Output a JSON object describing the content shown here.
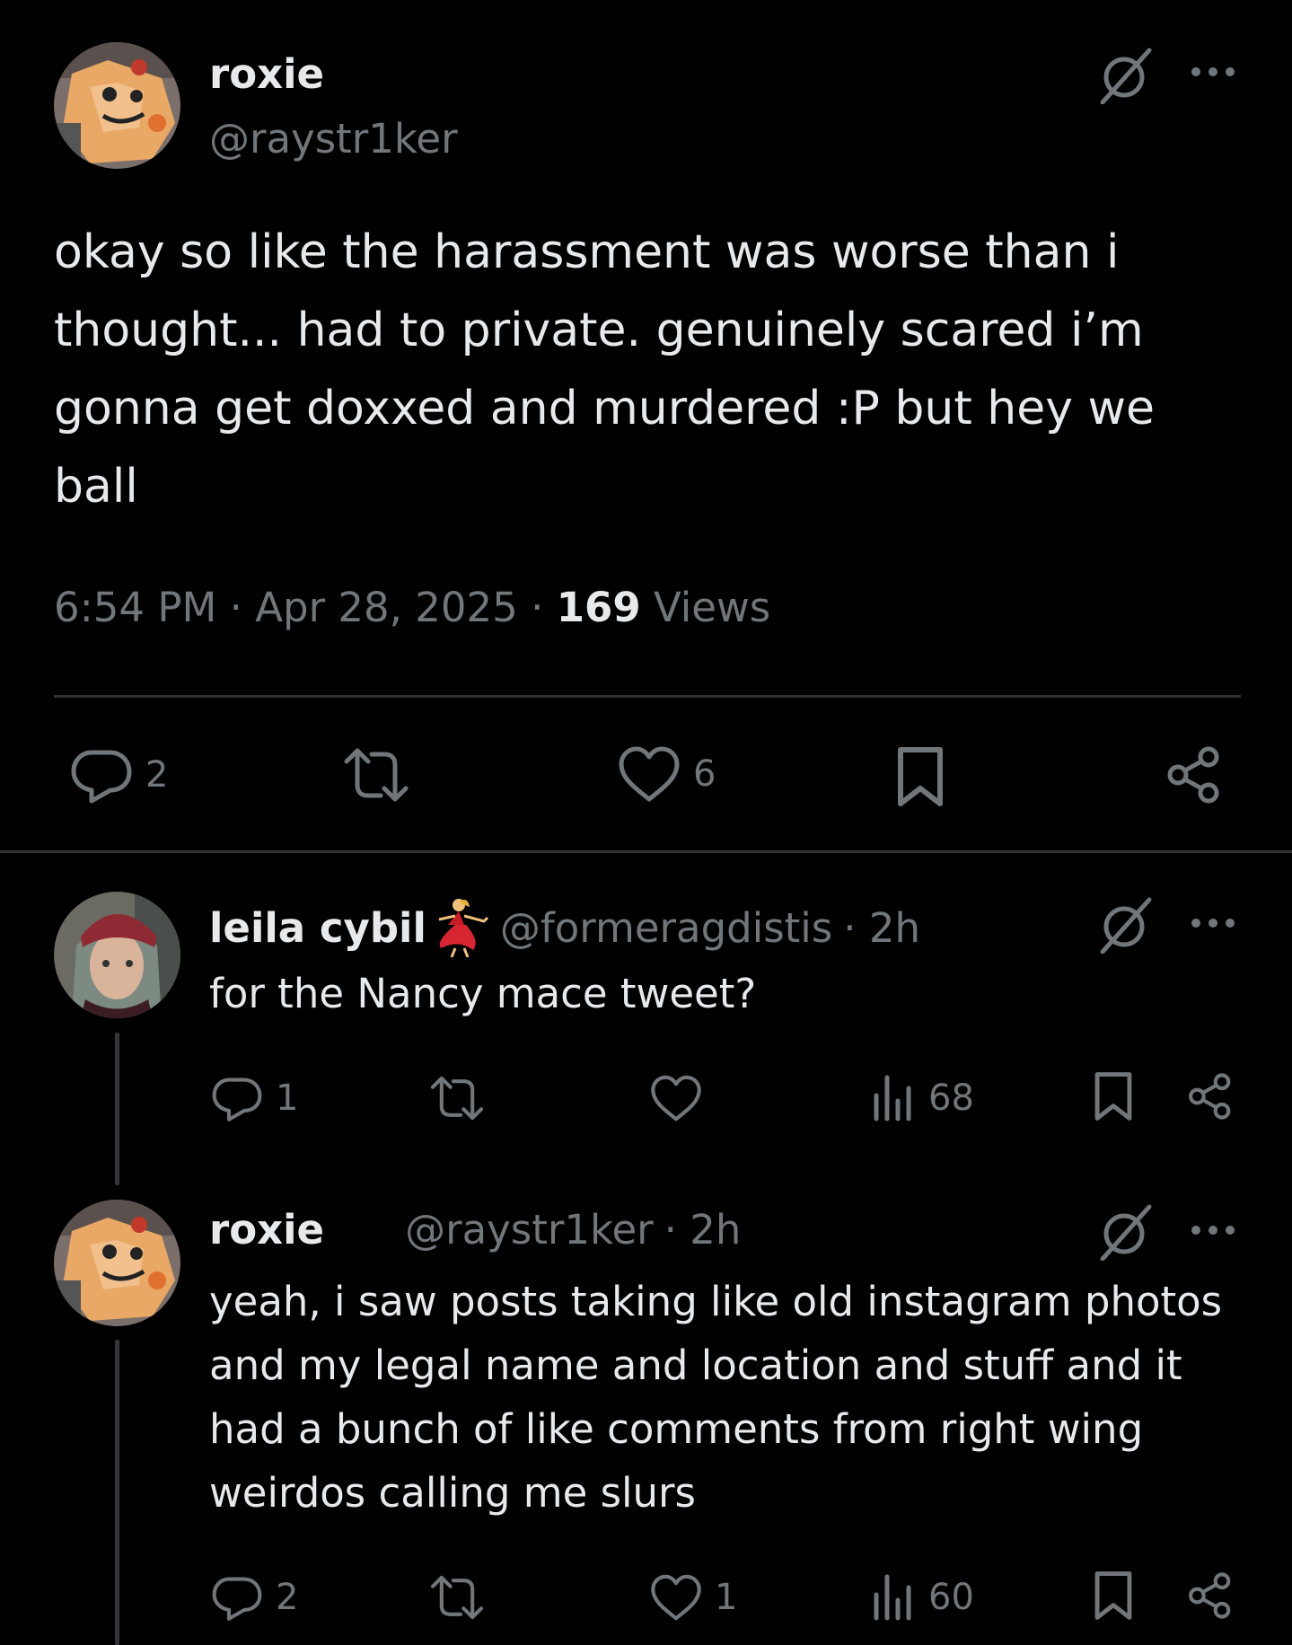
{
  "main_post": {
    "display_name": "roxie",
    "handle": "@raystr1ker",
    "text": "okay so like the harassment was worse than i thought... had to private. genuinely scared i’m gonna get doxxed and murdered :P but hey we ball",
    "time": "6:54 PM",
    "separator": "·",
    "date": "Apr 28, 2025",
    "views_count": "169",
    "views_label": "Views",
    "reply_count": "2",
    "like_count": "6"
  },
  "replies": [
    {
      "display_name": "leila cybil",
      "handle": "@formeragdistis",
      "age": "· 2h",
      "text": "for the Nancy mace tweet?",
      "reply_count": "1",
      "views": "68"
    },
    {
      "display_name": "roxie",
      "handle": "@raystr1ker",
      "age": "· 2h",
      "text": "yeah, i saw posts taking like old instagram photos and my legal name and location and stuff and it had a bunch of like comments from right wing weirdos calling me slurs",
      "reply_count": "2",
      "like_count": "1",
      "views": "60"
    }
  ],
  "colors": {
    "background": "#000000",
    "text_primary": "#e7e9ea",
    "text_secondary": "#71767b",
    "divider": "#2f3336"
  },
  "icons": [
    "grok-icon",
    "more-icon",
    "reply-icon",
    "repost-icon",
    "like-icon",
    "bookmark-icon",
    "share-icon",
    "views-icon",
    "dancer-emoji"
  ]
}
